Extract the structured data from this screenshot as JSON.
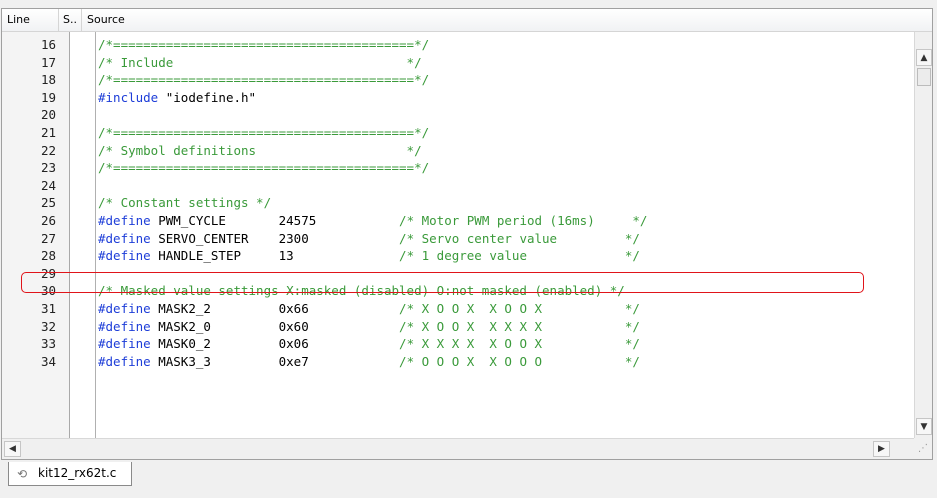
{
  "editor": {
    "columns": {
      "line": "Line",
      "s": "S..",
      "source": "Source"
    },
    "lines": [
      {
        "num": "16",
        "tokens": [
          {
            "text": "/*========================================*/",
            "kind": "comment"
          }
        ]
      },
      {
        "num": "17",
        "tokens": [
          {
            "text": "/* Include                               */",
            "kind": "comment"
          }
        ]
      },
      {
        "num": "18",
        "tokens": [
          {
            "text": "/*========================================*/",
            "kind": "comment"
          }
        ]
      },
      {
        "num": "19",
        "tokens": [
          {
            "text": "#include",
            "kind": "keyword"
          },
          {
            "text": " \"iodefine.h\"",
            "kind": "plain"
          }
        ]
      },
      {
        "num": "20",
        "tokens": []
      },
      {
        "num": "21",
        "tokens": [
          {
            "text": "/*========================================*/",
            "kind": "comment"
          }
        ]
      },
      {
        "num": "22",
        "tokens": [
          {
            "text": "/* Symbol definitions                    */",
            "kind": "comment"
          }
        ]
      },
      {
        "num": "23",
        "tokens": [
          {
            "text": "/*========================================*/",
            "kind": "comment"
          }
        ]
      },
      {
        "num": "24",
        "tokens": []
      },
      {
        "num": "25",
        "tokens": [
          {
            "text": "/* Constant settings */",
            "kind": "comment"
          }
        ]
      },
      {
        "num": "26",
        "tokens": [
          {
            "text": "#define",
            "kind": "keyword"
          },
          {
            "text": " PWM_CYCLE       24575           ",
            "kind": "plain"
          },
          {
            "text": "/* Motor PWM period (16ms)     */",
            "kind": "comment"
          }
        ]
      },
      {
        "num": "27",
        "tokens": [
          {
            "text": "#define",
            "kind": "keyword"
          },
          {
            "text": " SERVO_CENTER    2300            ",
            "kind": "plain"
          },
          {
            "text": "/* Servo center value         */",
            "kind": "comment"
          }
        ]
      },
      {
        "num": "28",
        "tokens": [
          {
            "text": "#define",
            "kind": "keyword"
          },
          {
            "text": " HANDLE_STEP     13              ",
            "kind": "plain"
          },
          {
            "text": "/* 1 degree value             */",
            "kind": "comment"
          }
        ]
      },
      {
        "num": "29",
        "tokens": []
      },
      {
        "num": "30",
        "tokens": [
          {
            "text": "/* Masked value settings X:masked (disabled) O:not masked (enabled) */",
            "kind": "comment"
          }
        ]
      },
      {
        "num": "31",
        "tokens": [
          {
            "text": "#define",
            "kind": "keyword"
          },
          {
            "text": " MASK2_2         0x66            ",
            "kind": "plain"
          },
          {
            "text": "/* X O O X  X O O X           */",
            "kind": "comment"
          }
        ]
      },
      {
        "num": "32",
        "tokens": [
          {
            "text": "#define",
            "kind": "keyword"
          },
          {
            "text": " MASK2_0         0x60            ",
            "kind": "plain"
          },
          {
            "text": "/* X O O X  X X X X           */",
            "kind": "comment"
          }
        ]
      },
      {
        "num": "33",
        "tokens": [
          {
            "text": "#define",
            "kind": "keyword"
          },
          {
            "text": " MASK0_2         0x06            ",
            "kind": "plain"
          },
          {
            "text": "/* X X X X  X O O X           */",
            "kind": "comment"
          }
        ]
      },
      {
        "num": "34",
        "tokens": [
          {
            "text": "#define",
            "kind": "keyword"
          },
          {
            "text": " MASK3_3         0xe7            ",
            "kind": "plain"
          },
          {
            "text": "/* O O O X  X O O O           */",
            "kind": "comment"
          }
        ]
      }
    ],
    "highlighted_line": "27",
    "colors": {
      "comment": "#3a9a3a",
      "keyword": "#1d3dd8",
      "highlight_border": "#e0141a"
    }
  },
  "scrollbars": {
    "up_icon": "arrow-up-icon",
    "down_icon": "arrow-down-icon",
    "left_icon": "arrow-left-icon",
    "right_icon": "arrow-right-icon"
  },
  "tabs": [
    {
      "label": "kit12_rx62t.c",
      "icon": "source-file-icon",
      "active": true
    }
  ]
}
